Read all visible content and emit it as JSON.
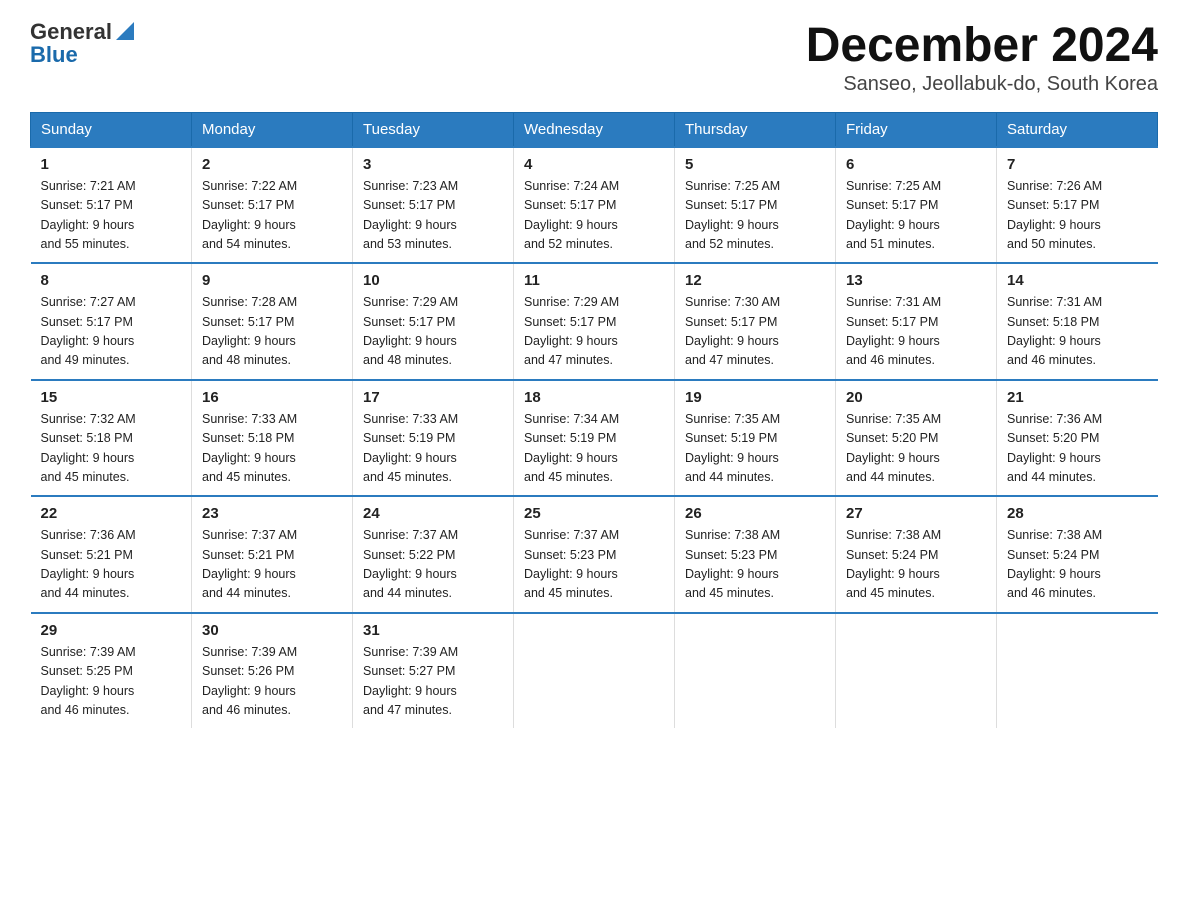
{
  "header": {
    "logo_general": "General",
    "logo_blue": "Blue",
    "title": "December 2024",
    "subtitle": "Sanseo, Jeollabuk-do, South Korea"
  },
  "days_of_week": [
    "Sunday",
    "Monday",
    "Tuesday",
    "Wednesday",
    "Thursday",
    "Friday",
    "Saturday"
  ],
  "weeks": [
    [
      {
        "day": "1",
        "sunrise": "7:21 AM",
        "sunset": "5:17 PM",
        "daylight": "9 hours and 55 minutes."
      },
      {
        "day": "2",
        "sunrise": "7:22 AM",
        "sunset": "5:17 PM",
        "daylight": "9 hours and 54 minutes."
      },
      {
        "day": "3",
        "sunrise": "7:23 AM",
        "sunset": "5:17 PM",
        "daylight": "9 hours and 53 minutes."
      },
      {
        "day": "4",
        "sunrise": "7:24 AM",
        "sunset": "5:17 PM",
        "daylight": "9 hours and 52 minutes."
      },
      {
        "day": "5",
        "sunrise": "7:25 AM",
        "sunset": "5:17 PM",
        "daylight": "9 hours and 52 minutes."
      },
      {
        "day": "6",
        "sunrise": "7:25 AM",
        "sunset": "5:17 PM",
        "daylight": "9 hours and 51 minutes."
      },
      {
        "day": "7",
        "sunrise": "7:26 AM",
        "sunset": "5:17 PM",
        "daylight": "9 hours and 50 minutes."
      }
    ],
    [
      {
        "day": "8",
        "sunrise": "7:27 AM",
        "sunset": "5:17 PM",
        "daylight": "9 hours and 49 minutes."
      },
      {
        "day": "9",
        "sunrise": "7:28 AM",
        "sunset": "5:17 PM",
        "daylight": "9 hours and 48 minutes."
      },
      {
        "day": "10",
        "sunrise": "7:29 AM",
        "sunset": "5:17 PM",
        "daylight": "9 hours and 48 minutes."
      },
      {
        "day": "11",
        "sunrise": "7:29 AM",
        "sunset": "5:17 PM",
        "daylight": "9 hours and 47 minutes."
      },
      {
        "day": "12",
        "sunrise": "7:30 AM",
        "sunset": "5:17 PM",
        "daylight": "9 hours and 47 minutes."
      },
      {
        "day": "13",
        "sunrise": "7:31 AM",
        "sunset": "5:17 PM",
        "daylight": "9 hours and 46 minutes."
      },
      {
        "day": "14",
        "sunrise": "7:31 AM",
        "sunset": "5:18 PM",
        "daylight": "9 hours and 46 minutes."
      }
    ],
    [
      {
        "day": "15",
        "sunrise": "7:32 AM",
        "sunset": "5:18 PM",
        "daylight": "9 hours and 45 minutes."
      },
      {
        "day": "16",
        "sunrise": "7:33 AM",
        "sunset": "5:18 PM",
        "daylight": "9 hours and 45 minutes."
      },
      {
        "day": "17",
        "sunrise": "7:33 AM",
        "sunset": "5:19 PM",
        "daylight": "9 hours and 45 minutes."
      },
      {
        "day": "18",
        "sunrise": "7:34 AM",
        "sunset": "5:19 PM",
        "daylight": "9 hours and 45 minutes."
      },
      {
        "day": "19",
        "sunrise": "7:35 AM",
        "sunset": "5:19 PM",
        "daylight": "9 hours and 44 minutes."
      },
      {
        "day": "20",
        "sunrise": "7:35 AM",
        "sunset": "5:20 PM",
        "daylight": "9 hours and 44 minutes."
      },
      {
        "day": "21",
        "sunrise": "7:36 AM",
        "sunset": "5:20 PM",
        "daylight": "9 hours and 44 minutes."
      }
    ],
    [
      {
        "day": "22",
        "sunrise": "7:36 AM",
        "sunset": "5:21 PM",
        "daylight": "9 hours and 44 minutes."
      },
      {
        "day": "23",
        "sunrise": "7:37 AM",
        "sunset": "5:21 PM",
        "daylight": "9 hours and 44 minutes."
      },
      {
        "day": "24",
        "sunrise": "7:37 AM",
        "sunset": "5:22 PM",
        "daylight": "9 hours and 44 minutes."
      },
      {
        "day": "25",
        "sunrise": "7:37 AM",
        "sunset": "5:23 PM",
        "daylight": "9 hours and 45 minutes."
      },
      {
        "day": "26",
        "sunrise": "7:38 AM",
        "sunset": "5:23 PM",
        "daylight": "9 hours and 45 minutes."
      },
      {
        "day": "27",
        "sunrise": "7:38 AM",
        "sunset": "5:24 PM",
        "daylight": "9 hours and 45 minutes."
      },
      {
        "day": "28",
        "sunrise": "7:38 AM",
        "sunset": "5:24 PM",
        "daylight": "9 hours and 46 minutes."
      }
    ],
    [
      {
        "day": "29",
        "sunrise": "7:39 AM",
        "sunset": "5:25 PM",
        "daylight": "9 hours and 46 minutes."
      },
      {
        "day": "30",
        "sunrise": "7:39 AM",
        "sunset": "5:26 PM",
        "daylight": "9 hours and 46 minutes."
      },
      {
        "day": "31",
        "sunrise": "7:39 AM",
        "sunset": "5:27 PM",
        "daylight": "9 hours and 47 minutes."
      },
      null,
      null,
      null,
      null
    ]
  ],
  "labels": {
    "sunrise": "Sunrise:",
    "sunset": "Sunset:",
    "daylight": "Daylight:"
  }
}
